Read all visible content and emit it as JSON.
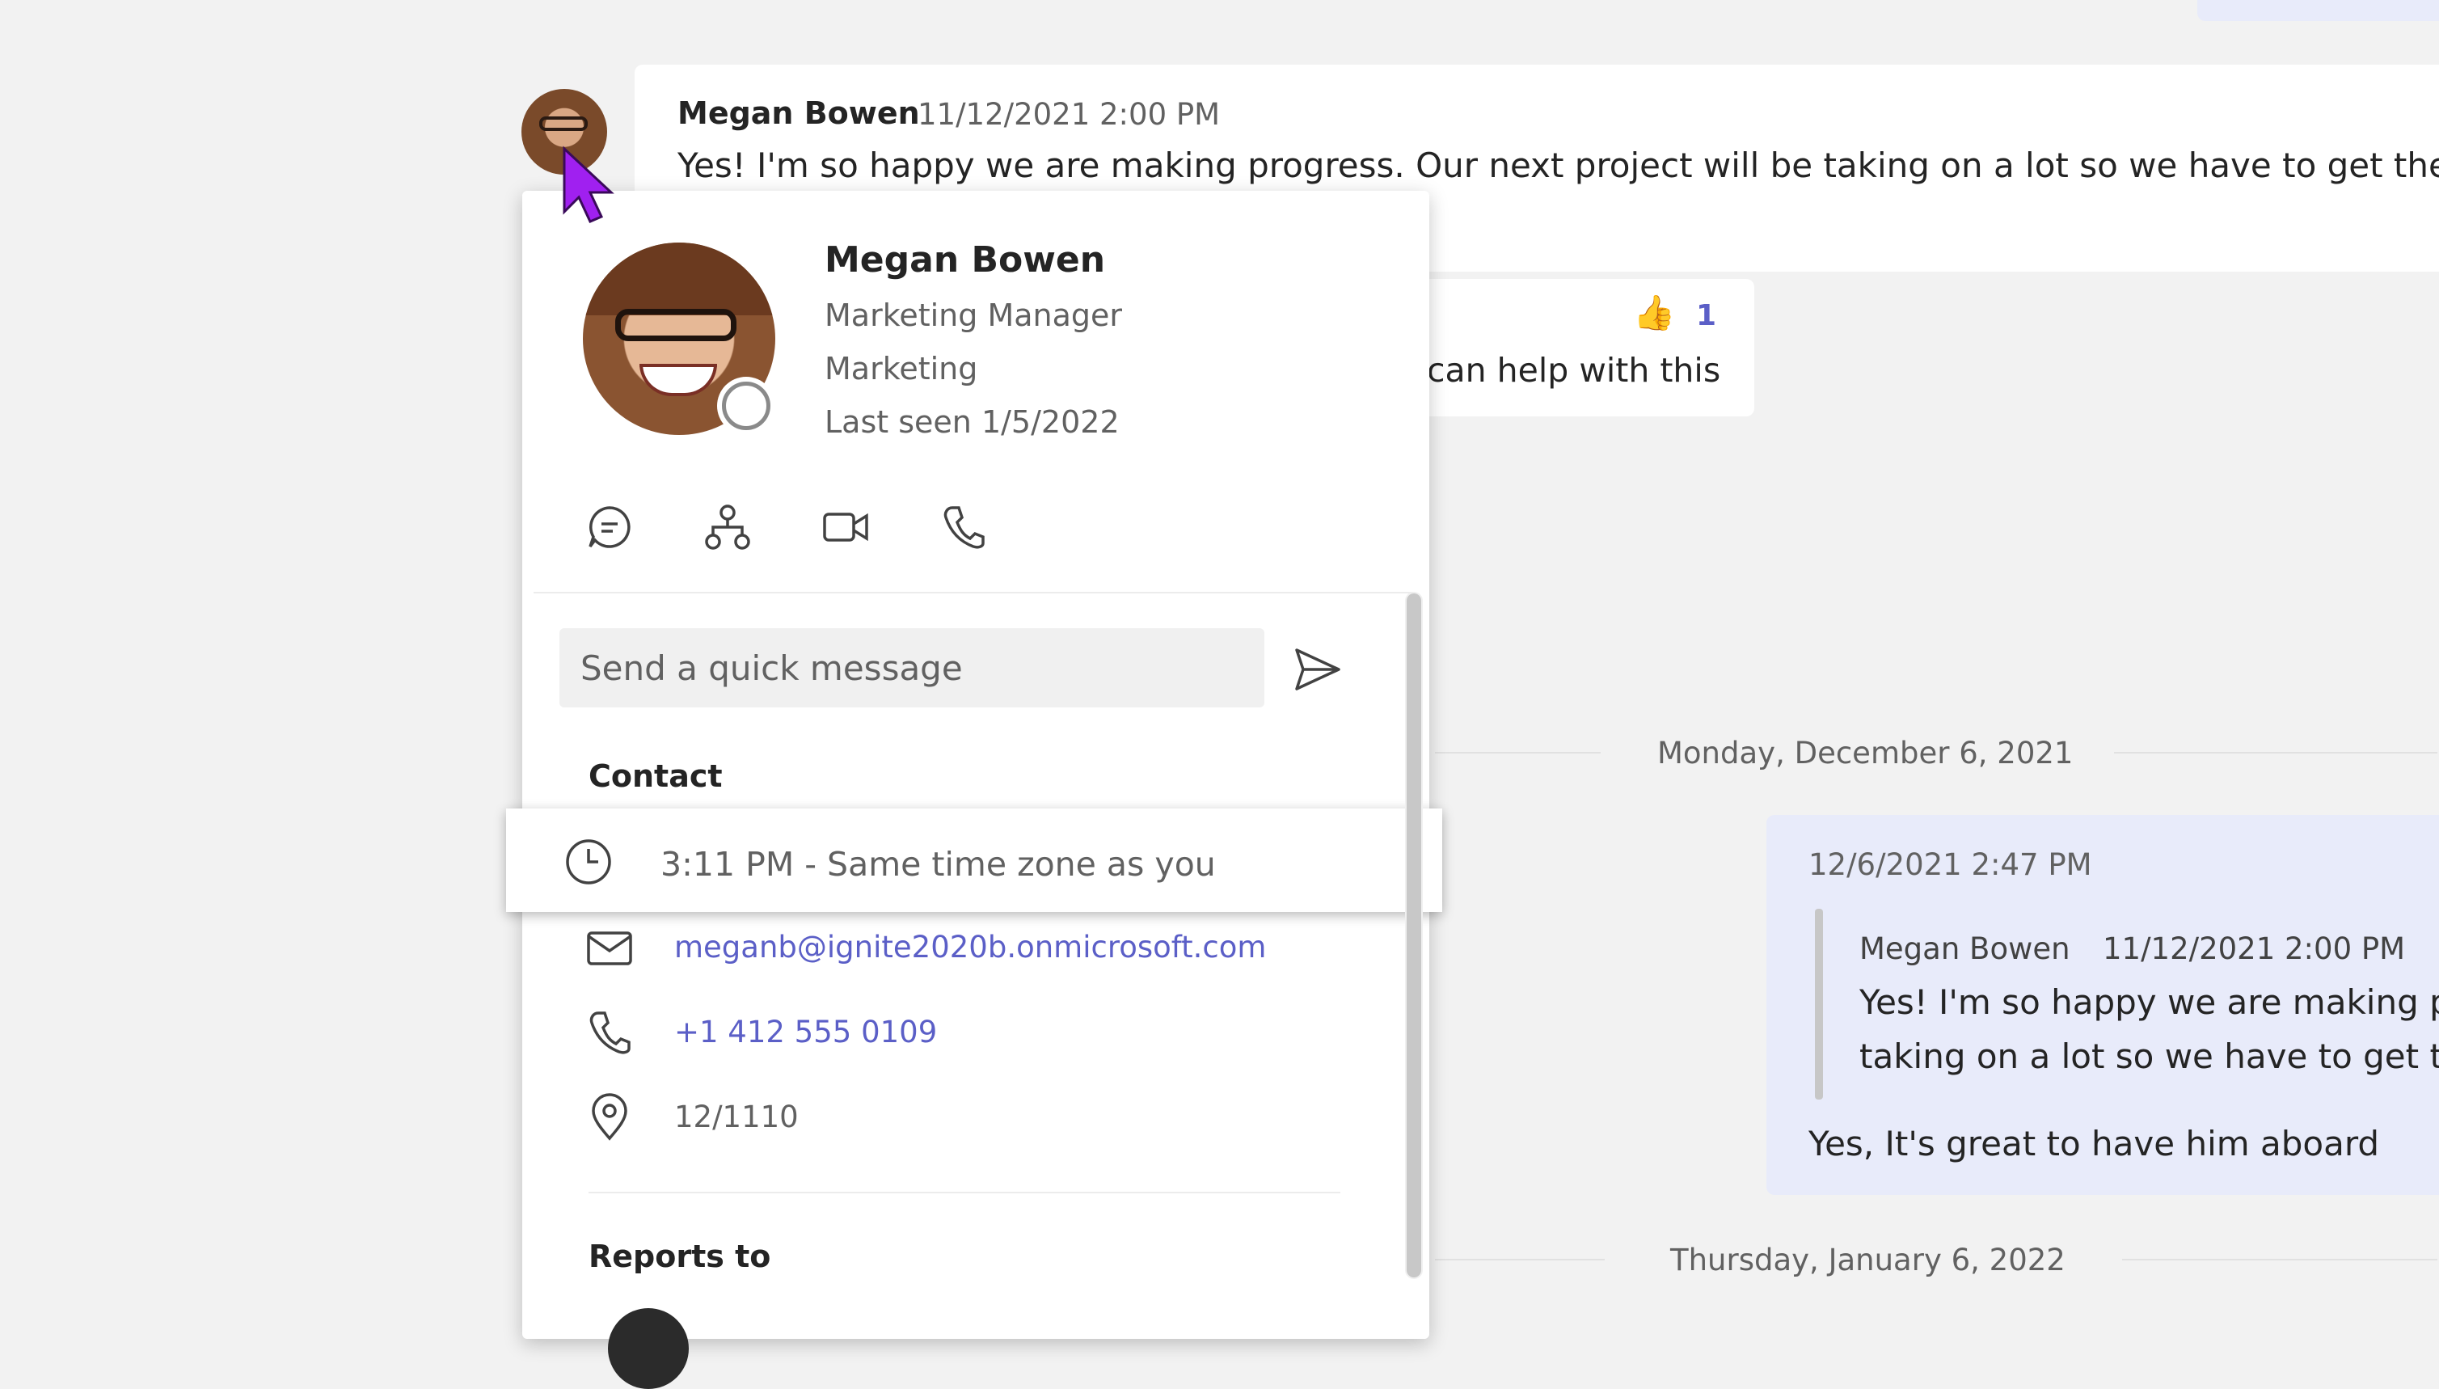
{
  "background_chat": {
    "message": {
      "sender": "Megan Bowen",
      "time": "11/12/2021 2:00 PM",
      "body": "Yes! I'm so happy we are making progress. Our next project will be taking on a lot so we have to get the bal"
    },
    "reply": {
      "reaction_emoji": "👍",
      "reaction_count": "1",
      "text": "can help with this"
    },
    "date_divider_1": "Monday, December 6, 2021",
    "my_message": {
      "time": "12/6/2021 2:47 PM",
      "quote_sender": "Megan Bowen",
      "quote_time": "11/12/2021 2:00 PM",
      "quote_line_1": "Yes! I'm so happy we are making pr",
      "quote_line_2": "taking on a lot so we have to get th",
      "text": "Yes, It's great to have him aboard"
    },
    "date_divider_2": "Thursday, January 6, 2022"
  },
  "profile_card": {
    "name": "Megan Bowen",
    "title": "Marketing Manager",
    "department": "Marketing",
    "last_seen": "Last seen 1/5/2022",
    "presence_color": "#8a8a8a",
    "actions": [
      "chat-icon",
      "org-chart-icon",
      "video-call-icon",
      "phone-call-icon"
    ],
    "quick_message_placeholder": "Send a quick message",
    "contact_heading": "Contact",
    "local_time": "3:11 PM - Same time zone as you",
    "email": "meganb@ignite2020b.onmicrosoft.com",
    "phone": "+1 412 555 0109",
    "location": "12/1110",
    "reports_to_heading": "Reports to"
  },
  "colors": {
    "accent": "#5b5fc7",
    "my_bubble": "#e8ebfa",
    "cursor": "#a020f0"
  }
}
